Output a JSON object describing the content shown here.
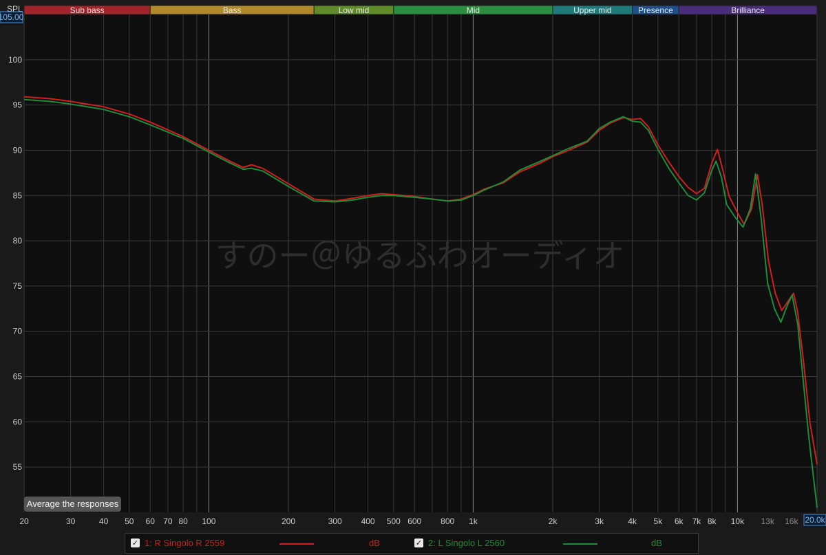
{
  "bands": [
    {
      "label": "Sub bass",
      "from": 20,
      "to": 60,
      "color": "#a1242b"
    },
    {
      "label": "Bass",
      "from": 60,
      "to": 250,
      "color": "#b08a2a"
    },
    {
      "label": "Low mid",
      "from": 250,
      "to": 500,
      "color": "#5e8a27"
    },
    {
      "label": "Mid",
      "from": 500,
      "to": 2000,
      "color": "#2a8d3f"
    },
    {
      "label": "Upper mid",
      "from": 2000,
      "to": 4000,
      "color": "#1f7a7a"
    },
    {
      "label": "Presence",
      "from": 4000,
      "to": 6000,
      "color": "#1f4f8a"
    },
    {
      "label": "Brilliance",
      "from": 6000,
      "to": 20000,
      "color": "#4a2d7a"
    }
  ],
  "axis": {
    "y_label": "SPL",
    "y_top_value": "105.00",
    "x_right_value": "20.0k"
  },
  "watermark": "すのー＠ゆるふわオーディオ",
  "buttons": {
    "average": "Average the responses"
  },
  "legend": [
    {
      "label": "1: R Singolo R 2559",
      "unit": "dB",
      "color": "#d01f1f"
    },
    {
      "label": "2: L Singolo L 2560",
      "unit": "dB",
      "color": "#1e8c3a"
    }
  ],
  "chart_data": {
    "type": "line",
    "x_scale": "log",
    "xlim": [
      20,
      20000
    ],
    "ylim": [
      50,
      105
    ],
    "ylabel": "SPL",
    "x_ticks": [
      {
        "v": 20,
        "t": "20"
      },
      {
        "v": 30,
        "t": "30"
      },
      {
        "v": 40,
        "t": "40"
      },
      {
        "v": 50,
        "t": "50"
      },
      {
        "v": 60,
        "t": "60"
      },
      {
        "v": 70,
        "t": "70"
      },
      {
        "v": 80,
        "t": "80"
      },
      {
        "v": 100,
        "t": "100"
      },
      {
        "v": 200,
        "t": "200"
      },
      {
        "v": 300,
        "t": "300"
      },
      {
        "v": 400,
        "t": "400"
      },
      {
        "v": 500,
        "t": "500"
      },
      {
        "v": 600,
        "t": "600"
      },
      {
        "v": 800,
        "t": "800"
      },
      {
        "v": 1000,
        "t": "1k"
      },
      {
        "v": 2000,
        "t": "2k"
      },
      {
        "v": 3000,
        "t": "3k"
      },
      {
        "v": 4000,
        "t": "4k"
      },
      {
        "v": 5000,
        "t": "5k"
      },
      {
        "v": 6000,
        "t": "6k"
      },
      {
        "v": 7000,
        "t": "7k"
      },
      {
        "v": 8000,
        "t": "8k"
      },
      {
        "v": 10000,
        "t": "10k"
      },
      {
        "v": 13000,
        "t": "13k"
      },
      {
        "v": 16000,
        "t": "16k"
      }
    ],
    "y_ticks": [
      55,
      60,
      65,
      70,
      75,
      80,
      85,
      90,
      95,
      100
    ],
    "series": [
      {
        "name": "1: R Singolo R 2559",
        "color": "#d01f1f",
        "points": [
          [
            20,
            95.9
          ],
          [
            25,
            95.7
          ],
          [
            30,
            95.4
          ],
          [
            40,
            94.8
          ],
          [
            50,
            94.0
          ],
          [
            60,
            93.1
          ],
          [
            80,
            91.5
          ],
          [
            100,
            90.0
          ],
          [
            120,
            88.8
          ],
          [
            135,
            88.1
          ],
          [
            145,
            88.4
          ],
          [
            160,
            88.0
          ],
          [
            200,
            86.3
          ],
          [
            250,
            84.6
          ],
          [
            300,
            84.4
          ],
          [
            350,
            84.7
          ],
          [
            400,
            85.0
          ],
          [
            450,
            85.2
          ],
          [
            500,
            85.1
          ],
          [
            600,
            84.9
          ],
          [
            700,
            84.6
          ],
          [
            800,
            84.4
          ],
          [
            900,
            84.6
          ],
          [
            1000,
            85.1
          ],
          [
            1100,
            85.7
          ],
          [
            1300,
            86.4
          ],
          [
            1500,
            87.6
          ],
          [
            1800,
            88.6
          ],
          [
            2000,
            89.3
          ],
          [
            2300,
            90.0
          ],
          [
            2700,
            90.9
          ],
          [
            3000,
            92.2
          ],
          [
            3300,
            93.0
          ],
          [
            3700,
            93.6
          ],
          [
            4000,
            93.4
          ],
          [
            4300,
            93.5
          ],
          [
            4600,
            92.6
          ],
          [
            5000,
            90.6
          ],
          [
            5500,
            88.7
          ],
          [
            6000,
            87.1
          ],
          [
            6500,
            85.9
          ],
          [
            7000,
            85.2
          ],
          [
            7500,
            85.8
          ],
          [
            8000,
            88.6
          ],
          [
            8400,
            90.1
          ],
          [
            8800,
            87.8
          ],
          [
            9300,
            84.9
          ],
          [
            10000,
            83.1
          ],
          [
            10600,
            81.8
          ],
          [
            11300,
            83.5
          ],
          [
            11900,
            87.3
          ],
          [
            12400,
            84.0
          ],
          [
            13100,
            77.8
          ],
          [
            13900,
            74.2
          ],
          [
            14700,
            72.3
          ],
          [
            15600,
            73.4
          ],
          [
            16300,
            74.2
          ],
          [
            16900,
            72.1
          ],
          [
            17800,
            66.5
          ],
          [
            18800,
            59.9
          ],
          [
            20000,
            55.3
          ]
        ]
      },
      {
        "name": "2: L Singolo L 2560",
        "color": "#1e8c3a",
        "points": [
          [
            20,
            95.6
          ],
          [
            25,
            95.4
          ],
          [
            30,
            95.1
          ],
          [
            40,
            94.5
          ],
          [
            50,
            93.7
          ],
          [
            60,
            92.8
          ],
          [
            80,
            91.3
          ],
          [
            100,
            89.8
          ],
          [
            120,
            88.6
          ],
          [
            135,
            87.9
          ],
          [
            145,
            88.0
          ],
          [
            160,
            87.7
          ],
          [
            200,
            86.0
          ],
          [
            250,
            84.4
          ],
          [
            300,
            84.3
          ],
          [
            350,
            84.5
          ],
          [
            400,
            84.8
          ],
          [
            450,
            85.0
          ],
          [
            500,
            85.0
          ],
          [
            600,
            84.8
          ],
          [
            700,
            84.6
          ],
          [
            800,
            84.4
          ],
          [
            900,
            84.5
          ],
          [
            1000,
            85.0
          ],
          [
            1100,
            85.6
          ],
          [
            1300,
            86.5
          ],
          [
            1500,
            87.8
          ],
          [
            1800,
            88.8
          ],
          [
            2000,
            89.4
          ],
          [
            2300,
            90.2
          ],
          [
            2700,
            91.0
          ],
          [
            3000,
            92.4
          ],
          [
            3300,
            93.1
          ],
          [
            3700,
            93.7
          ],
          [
            4000,
            93.2
          ],
          [
            4300,
            93.1
          ],
          [
            4600,
            92.2
          ],
          [
            5000,
            90.1
          ],
          [
            5500,
            88.0
          ],
          [
            6000,
            86.4
          ],
          [
            6500,
            85.0
          ],
          [
            7000,
            84.5
          ],
          [
            7500,
            85.3
          ],
          [
            8000,
            87.8
          ],
          [
            8300,
            88.8
          ],
          [
            8700,
            87.0
          ],
          [
            9100,
            84.0
          ],
          [
            9800,
            82.6
          ],
          [
            10500,
            81.5
          ],
          [
            11200,
            83.6
          ],
          [
            11700,
            87.4
          ],
          [
            12300,
            82.4
          ],
          [
            13000,
            75.3
          ],
          [
            13800,
            72.5
          ],
          [
            14600,
            71.0
          ],
          [
            15400,
            72.8
          ],
          [
            16100,
            74.0
          ],
          [
            16900,
            70.8
          ],
          [
            17700,
            64.8
          ],
          [
            18600,
            58.4
          ],
          [
            20000,
            50.5
          ]
        ]
      }
    ]
  }
}
